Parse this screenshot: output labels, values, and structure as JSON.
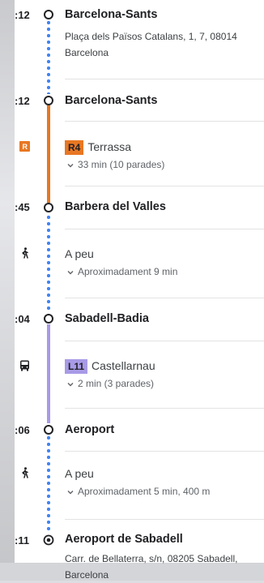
{
  "stops": [
    {
      "time": ":12",
      "name": "Barcelona-Sants",
      "address": "Plaça dels Països Catalans, 1, 7, 08014",
      "city": "Barcelona"
    },
    {
      "time": ":12",
      "name": "Barcelona-Sants"
    },
    {
      "time": ":45",
      "name": "Barbera del Valles"
    },
    {
      "time": ":04",
      "name": "Sabadell-Badia"
    },
    {
      "time": ":06",
      "name": "Aeroport"
    },
    {
      "time": ":11",
      "name": "Aeroport de Sabadell",
      "address": "Carr. de Bellaterra, s/n, 08205 Sabadell,",
      "city": "Barcelona"
    }
  ],
  "segments": [
    {
      "mode": "train",
      "icon": "rail-icon",
      "line": "R4",
      "line_color": "#e87722",
      "headsign": "Terrassa",
      "detail": "33 min (10 parades)"
    },
    {
      "mode": "walk",
      "icon": "walk-icon",
      "label": "A peu",
      "detail": "Aproximadament 9 min"
    },
    {
      "mode": "bus",
      "icon": "bus-icon",
      "line": "L11",
      "line_color": "#a89ae6",
      "headsign": "Castellarnau",
      "detail": "2 min (3 parades)"
    },
    {
      "mode": "walk",
      "icon": "walk-icon",
      "label": "A peu",
      "detail": "Aproximadament 5 min, 400 m"
    }
  ],
  "colors": {
    "train_line": "#e87722",
    "bus_line": "#a89ae6",
    "walk_dots": "#4285f4"
  }
}
